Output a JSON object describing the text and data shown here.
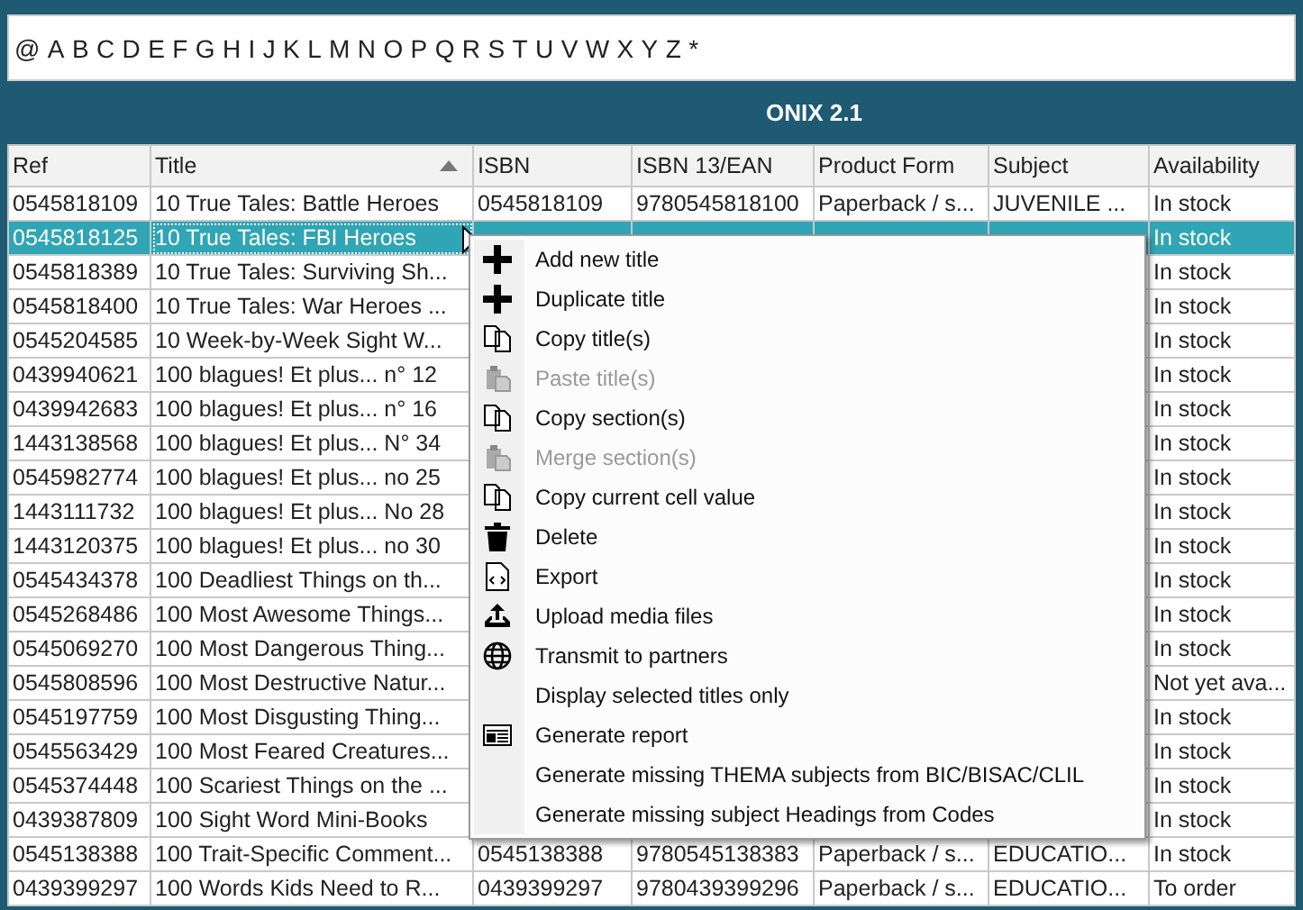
{
  "letters": [
    "@",
    "A",
    "B",
    "C",
    "D",
    "E",
    "F",
    "G",
    "H",
    "I",
    "J",
    "K",
    "L",
    "M",
    "N",
    "O",
    "P",
    "Q",
    "R",
    "S",
    "T",
    "U",
    "V",
    "W",
    "X",
    "Y",
    "Z",
    "*"
  ],
  "heading": "ONIX 2.1",
  "table": {
    "columns": [
      {
        "label": "Ref",
        "sorted": false
      },
      {
        "label": "Title",
        "sorted": true
      },
      {
        "label": "ISBN",
        "sorted": false
      },
      {
        "label": "ISBN 13/EAN",
        "sorted": false
      },
      {
        "label": "Product Form",
        "sorted": false
      },
      {
        "label": "Subject",
        "sorted": false
      },
      {
        "label": "Availability",
        "sorted": false
      }
    ],
    "rows": [
      {
        "selected": false,
        "cells": [
          "0545818109",
          "10 True Tales: Battle Heroes",
          "0545818109",
          "9780545818100",
          "Paperback / s...",
          "JUVENILE ...",
          "In stock"
        ]
      },
      {
        "selected": true,
        "cells": [
          "0545818125",
          "10 True Tales: FBI Heroes",
          null,
          null,
          null,
          null,
          "In stock"
        ]
      },
      {
        "selected": false,
        "cells": [
          "0545818389",
          "10 True Tales: Surviving Sh...",
          null,
          null,
          null,
          null,
          "In stock"
        ]
      },
      {
        "selected": false,
        "cells": [
          "0545818400",
          "10 True Tales: War Heroes ...",
          null,
          null,
          null,
          null,
          "In stock"
        ]
      },
      {
        "selected": false,
        "cells": [
          "0545204585",
          "10 Week-by-Week Sight W...",
          null,
          null,
          null,
          null,
          "In stock"
        ]
      },
      {
        "selected": false,
        "cells": [
          "0439940621",
          "100 blagues! Et plus... n° 12",
          null,
          null,
          null,
          null,
          "In stock"
        ]
      },
      {
        "selected": false,
        "cells": [
          "0439942683",
          "100 blagues! Et plus... n° 16",
          null,
          null,
          null,
          null,
          "In stock"
        ]
      },
      {
        "selected": false,
        "cells": [
          "1443138568",
          "100 blagues! Et plus... N° 34",
          null,
          null,
          null,
          null,
          "In stock"
        ]
      },
      {
        "selected": false,
        "cells": [
          "0545982774",
          "100 blagues! Et plus... no 25",
          null,
          null,
          null,
          null,
          "In stock"
        ]
      },
      {
        "selected": false,
        "cells": [
          "1443111732",
          "100 blagues! Et plus... No 28",
          null,
          null,
          null,
          null,
          "In stock"
        ]
      },
      {
        "selected": false,
        "cells": [
          "1443120375",
          "100 blagues! Et plus... no 30",
          null,
          null,
          null,
          null,
          "In stock"
        ]
      },
      {
        "selected": false,
        "cells": [
          "0545434378",
          "100 Deadliest Things on th...",
          null,
          null,
          null,
          null,
          "In stock"
        ]
      },
      {
        "selected": false,
        "cells": [
          "0545268486",
          "100 Most Awesome Things...",
          null,
          null,
          null,
          null,
          "In stock"
        ]
      },
      {
        "selected": false,
        "cells": [
          "0545069270",
          "100 Most Dangerous Thing...",
          null,
          null,
          null,
          null,
          "In stock"
        ]
      },
      {
        "selected": false,
        "cells": [
          "0545808596",
          "100 Most Destructive Natur...",
          null,
          null,
          null,
          null,
          "Not yet ava..."
        ]
      },
      {
        "selected": false,
        "cells": [
          "0545197759",
          "100 Most Disgusting Thing...",
          null,
          null,
          null,
          null,
          "In stock"
        ]
      },
      {
        "selected": false,
        "cells": [
          "0545563429",
          "100 Most Feared Creatures...",
          null,
          null,
          null,
          null,
          "In stock"
        ]
      },
      {
        "selected": false,
        "cells": [
          "0545374448",
          "100 Scariest Things on the ...",
          null,
          null,
          null,
          null,
          "In stock"
        ]
      },
      {
        "selected": false,
        "cells": [
          "0439387809",
          "100 Sight Word Mini-Books",
          null,
          null,
          null,
          null,
          "In stock"
        ]
      },
      {
        "selected": false,
        "cells": [
          "0545138388",
          "100 Trait-Specific Comment...",
          "0545138388",
          "9780545138383",
          "Paperback / s...",
          "EDUCATIO...",
          "In stock"
        ]
      },
      {
        "selected": false,
        "cells": [
          "0439399297",
          "100 Words Kids Need to R...",
          "0439399297",
          "9780439399296",
          "Paperback / s...",
          "EDUCATIO...",
          "To order"
        ]
      }
    ]
  },
  "menu": [
    {
      "label": "Add new title",
      "kind": "plus",
      "disabled": false
    },
    {
      "label": "Duplicate title",
      "kind": "plus",
      "disabled": false
    },
    {
      "label": "Copy title(s)",
      "kind": "copy",
      "disabled": false
    },
    {
      "label": "Paste title(s)",
      "kind": "paste",
      "disabled": true
    },
    {
      "label": "Copy section(s)",
      "kind": "copy",
      "disabled": false
    },
    {
      "label": "Merge section(s)",
      "kind": "paste",
      "disabled": true
    },
    {
      "label": "Copy current cell value",
      "kind": "copy",
      "disabled": false
    },
    {
      "label": "Delete",
      "kind": "trash",
      "disabled": false
    },
    {
      "label": "Export",
      "kind": "export",
      "disabled": false
    },
    {
      "label": "Upload media files",
      "kind": "upload",
      "disabled": false
    },
    {
      "label": "Transmit to partners",
      "kind": "globe",
      "disabled": false
    },
    {
      "label": "Display selected titles only",
      "kind": "none",
      "disabled": false
    },
    {
      "label": "Generate report",
      "kind": "report",
      "disabled": false
    },
    {
      "label": "Generate missing THEMA subjects from BIC/BISAC/CLIL",
      "kind": "none",
      "disabled": false
    },
    {
      "label": "Generate missing subject Headings from Codes",
      "kind": "none",
      "disabled": false
    }
  ]
}
